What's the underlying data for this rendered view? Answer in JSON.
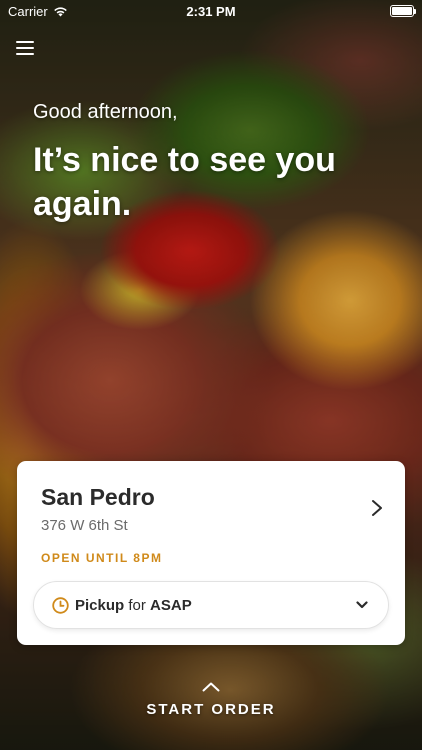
{
  "status_bar": {
    "carrier": "Carrier",
    "time": "2:31 PM",
    "icons": [
      "wifi-icon",
      "battery-icon"
    ]
  },
  "nav": {
    "menu_icon": "hamburger-menu-icon"
  },
  "hero": {
    "greeting": "Good afternoon,",
    "headline": "It’s nice to see you again."
  },
  "location_card": {
    "store_name": "San Pedro",
    "address": "376 W 6th St",
    "hours": "OPEN UNTIL 8PM",
    "order_mode": {
      "mode": "Pickup",
      "connector": "for",
      "time": "ASAP",
      "icon": "clock-icon"
    },
    "accent_color": "#d08a1a"
  },
  "footer": {
    "start_order_label": "START ORDER",
    "icon": "chevron-up-icon"
  }
}
